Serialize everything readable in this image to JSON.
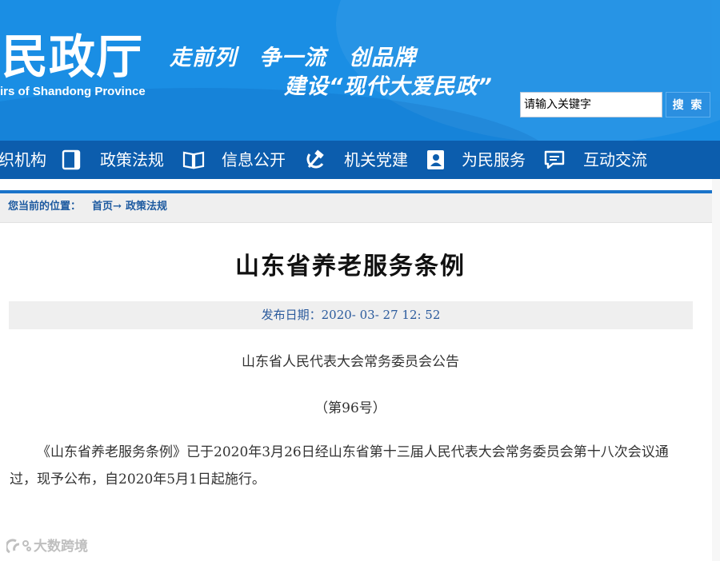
{
  "header": {
    "site_title": "民政厅",
    "site_subtitle": "irs of Shandong Province",
    "slogan_line1": "走前列　争一流　创品牌",
    "slogan_line2": "建设“现代大爱民政”"
  },
  "search": {
    "placeholder": "请输入关键字",
    "button_label": "搜 索"
  },
  "nav": {
    "items": [
      {
        "label": "织机构",
        "icon": "org-icon"
      },
      {
        "label": "政策法规",
        "icon": "book-icon"
      },
      {
        "label": "信息公开",
        "icon": "open-book-icon"
      },
      {
        "label": "机关党建",
        "icon": "hammer-sickle-icon"
      },
      {
        "label": "为民服务",
        "icon": "person-badge-icon"
      },
      {
        "label": "互动交流",
        "icon": "chat-icon"
      }
    ]
  },
  "breadcrumb": {
    "prefix": "您当前的位置：",
    "home": "首页",
    "arrow": "→",
    "current": "政策法规"
  },
  "article": {
    "title": "山东省养老服务条例",
    "date_label": "发布日期：",
    "date_value": "2020- 03- 27 12: 52",
    "org_line": "山东省人民代表大会常务委员会公告",
    "number_line": "（第96号）",
    "body": "《山东省养老服务条例》已于2020年3月26日经山东省第十三届人民代表大会常务委员会第十八次会议通过，现予公布，自2020年5月1日起施行。"
  },
  "watermark": {
    "text": "大数跨境"
  },
  "colors": {
    "header_blue": "#1a8ee4",
    "nav_blue": "#0c5dad",
    "link_blue": "#1d5aa0"
  }
}
